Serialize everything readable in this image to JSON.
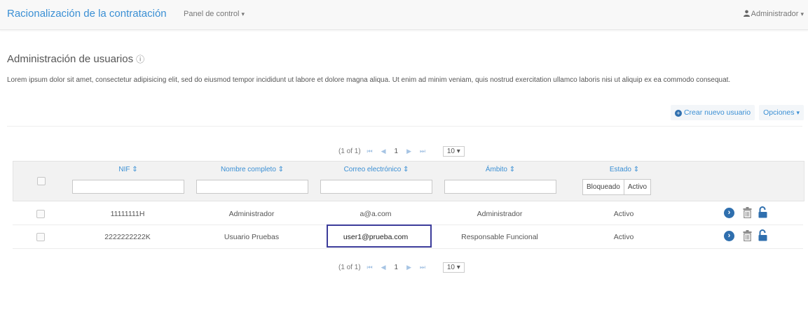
{
  "navbar": {
    "brand": "Racionalización de la contratación",
    "menu_label": "Panel de control",
    "user_label": "Administrador"
  },
  "page": {
    "title": "Administración de usuarios",
    "description": "Lorem ipsum dolor sit amet, consectetur adipisicing elit, sed do eiusmod tempor incididunt ut labore et dolore magna aliqua. Ut enim ad minim veniam, quis nostrud exercitation ullamco laboris nisi ut aliquip ex ea commodo consequat."
  },
  "actions": {
    "create_label": "Crear nuevo usuario",
    "options_label": "Opciones"
  },
  "pager": {
    "info": "(1 of 1)",
    "first": "⏮",
    "prev": "◀",
    "current": "1",
    "next": "▶",
    "last": "⏭",
    "rows_per_page": "10 ▾"
  },
  "table": {
    "headers": {
      "nif": "NIF ⇕",
      "nombre": "Nombre completo ⇕",
      "correo": "Correo electrónico ⇕",
      "ambito": "Ámbito ⇕",
      "estado": "Estado ⇕"
    },
    "estado_filter": {
      "bloqueado": "Bloqueado",
      "activo": "Activo"
    },
    "rows": [
      {
        "nif": "11111111H",
        "nombre": "Administrador",
        "correo": "a@a.com",
        "ambito": "Administrador",
        "estado": "Activo"
      },
      {
        "nif": "2222222222K",
        "nombre": "Usuario Pruebas",
        "correo": "user1@prueba.com",
        "ambito": "Responsable Funcional",
        "estado": "Activo"
      }
    ]
  },
  "colors": {
    "brand": "#3a8fd4",
    "icon": "#2f6fae",
    "highlight": "#3c3c9a"
  },
  "icons": [
    "user-icon",
    "info-circle-icon",
    "plus-circle-icon",
    "arrow-right-circle-icon",
    "trash-icon",
    "unlock-icon"
  ]
}
